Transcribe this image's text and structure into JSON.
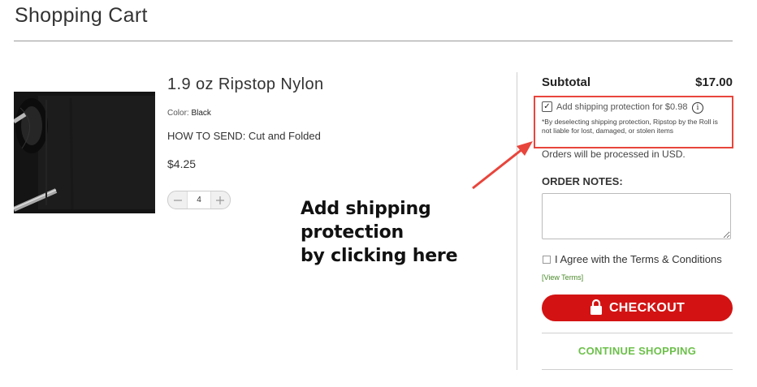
{
  "page": {
    "title": "Shopping Cart"
  },
  "product": {
    "name": "1.9 oz Ripstop Nylon",
    "color_label": "Color:",
    "color_value": "Black",
    "how_to_send": "HOW TO SEND: Cut and Folded",
    "price": "$4.25",
    "quantity": "4",
    "qty_minus_icon": "minus-icon",
    "qty_plus_icon": "plus-icon",
    "image_desc_color": "#161616"
  },
  "summary": {
    "subtotal_label": "Subtotal",
    "subtotal_value": "$17.00",
    "protection": {
      "checked": true,
      "label": "Add shipping protection for $0.98",
      "note": "*By deselecting shipping protection, Ripstop by the Roll is not liable for lost, damaged, or stolen items",
      "info_icon": "info-icon"
    },
    "orders_currency": "Orders will be processed in USD.",
    "order_notes_label": "ORDER NOTES:",
    "order_notes_value": "",
    "terms_label": "I Agree with the Terms & Conditions",
    "terms_checked": false,
    "view_terms": "[View Terms]",
    "checkout_label": "CHECKOUT",
    "continue_label": "CONTINUE SHOPPING"
  },
  "annotation": {
    "text_line1": "Add shipping protection",
    "text_line2": "by clicking here"
  },
  "colors": {
    "checkout_bg": "#d31313",
    "continue_text": "#6cc04a",
    "highlight_border": "#e8453c",
    "view_terms": "#4a8a2a"
  }
}
